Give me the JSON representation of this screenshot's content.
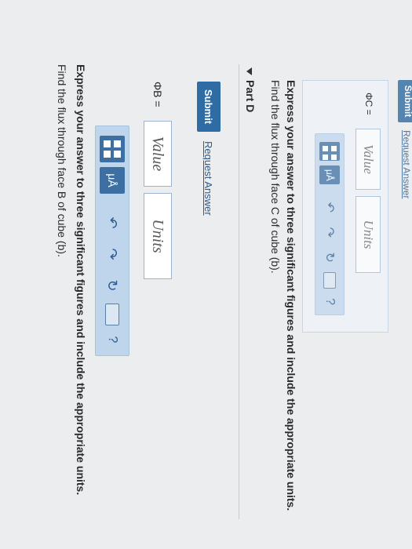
{
  "partC": {
    "question": "Find the flux through face B of cube (b).",
    "instruction": "Express your answer to three significant figures and include the appropriate units.",
    "symbol": "ΦB =",
    "value_placeholder": "Value",
    "units_placeholder": "Units",
    "submit_label": "Submit",
    "request_label": "Request Answer"
  },
  "partD": {
    "title": "Part D",
    "question": "Find the flux through face C of cube (b).",
    "instruction": "Express your answer to three significant figures and include the appropriate units.",
    "symbol": "ΦC =",
    "value_placeholder": "Value",
    "units_placeholder": "Units",
    "submit_label": "Submit",
    "request_label": "Request Answer"
  },
  "toolbar": {
    "mu_label": "μÅ",
    "undo_icon": "↶",
    "redo_icon": "↷",
    "reset_icon": "↻",
    "help_label": "?"
  },
  "colors": {
    "accent": "#2f6ca4",
    "toolbar_bg": "#bfd5ec"
  }
}
